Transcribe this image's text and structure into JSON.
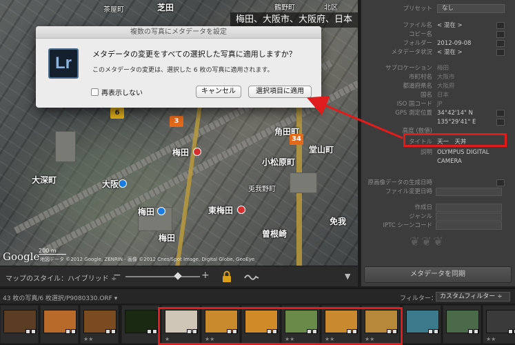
{
  "map": {
    "location_banner": "梅田、大阪市、大阪府、日本",
    "labels": [
      {
        "text": "茶屋町",
        "size": "sm"
      },
      {
        "text": "芝田",
        "size": "lg"
      },
      {
        "text": "鶴野町",
        "size": "sm"
      },
      {
        "text": "北区",
        "size": "sm"
      },
      {
        "text": "梅田",
        "size": "lg"
      },
      {
        "text": "角田町",
        "size": "lg"
      },
      {
        "text": "小松原町",
        "size": "lg"
      },
      {
        "text": "大阪",
        "size": "lg"
      },
      {
        "text": "大深町",
        "size": "lg"
      },
      {
        "text": "東梅田",
        "size": "lg"
      },
      {
        "text": "梅田",
        "size": "lg"
      },
      {
        "text": "曽根崎",
        "size": "lg"
      },
      {
        "text": "免我",
        "size": "lg"
      },
      {
        "text": "堂山町",
        "size": "lg"
      },
      {
        "text": "兎我野町",
        "size": "sm"
      },
      {
        "text": "梅田",
        "size": "lg"
      }
    ],
    "badges": [
      "6",
      "3",
      "34"
    ],
    "scale": "200 m",
    "google": "Google",
    "copyright": "地図データ ©2012 Google, ZENRIN - 画像 ©2012 Cnes/Spot Image, Digital Globe, GeoEye"
  },
  "dialog": {
    "title": "複数の写真にメタデータを設定",
    "icon_text": "Lr",
    "question": "メタデータの変更をすべての選択した写真に適用しますか？",
    "detail": "このメタデータの変更は、選択した 6 枚の写真に適用されます。",
    "dont_show": "再表示しない",
    "cancel": "キャンセル",
    "apply": "選択項目に適用"
  },
  "toolbar": {
    "map_style": "マップのスタイル：ハイブリッド ÷",
    "zoom_level": 0.72
  },
  "panel": {
    "preset_label": "プリセット",
    "preset_value": "なし",
    "rows": [
      {
        "label": "ファイル名",
        "value": "< 混在 >"
      },
      {
        "label": "コピー名",
        "value": ""
      },
      {
        "label": "フォルダー",
        "value": "2012-09-08"
      },
      {
        "label": "メタデータ状況",
        "value": "< 混在 >"
      },
      {
        "label": "サブロケーション",
        "value": "梅田",
        "dim": true
      },
      {
        "label": "市町村名",
        "value": "大阪市",
        "dim": true
      },
      {
        "label": "都道府県名",
        "value": "大阪府",
        "dim": true
      },
      {
        "label": "国名",
        "value": "日本",
        "dim": true
      },
      {
        "label": "ISO 国コード",
        "value": "JP",
        "dim": true
      },
      {
        "label": "GPS 測定位置",
        "value": "34°42'14\" N"
      },
      {
        "label": "",
        "value": "135°29'41\" E"
      },
      {
        "label": "高度 (数値)",
        "value": ""
      },
      {
        "label": "タイトル",
        "value": "天一　天丼"
      },
      {
        "label": "説明",
        "value": "OLYMPUS DIGITAL"
      },
      {
        "label": "",
        "value": "CAMERA"
      },
      {
        "label": "原画像データの生成日時",
        "value": ""
      },
      {
        "label": "ファイル変更日時",
        "value": ""
      },
      {
        "label": "作成日",
        "value": ""
      },
      {
        "label": "ジャンル",
        "value": ""
      },
      {
        "label": "IPTC シーンコード",
        "value": ""
      }
    ],
    "ornament": "❦❦❦",
    "sync_button": "メタデータを同期"
  },
  "filmstrip": {
    "count_text": "43 枚の写真/6 枚選択/P9080330.ORF ▾",
    "filter_label": "フィルター：",
    "filter_value": "カスタムフィルター ÷",
    "thumbs": [
      {
        "stars": "",
        "color": "#5a3d22"
      },
      {
        "stars": "",
        "color": "#b86a2a"
      },
      {
        "stars": "★★",
        "color": "#7a4a20"
      },
      {
        "stars": "",
        "color": "#1a2a12"
      },
      {
        "stars": "★",
        "color": "#cfc6b8"
      },
      {
        "stars": "★★",
        "color": "#c98a2e"
      },
      {
        "stars": "",
        "color": "#d18a28"
      },
      {
        "stars": "★★",
        "color": "#6a8a4a"
      },
      {
        "stars": "★★",
        "color": "#c9892e"
      },
      {
        "stars": "★★",
        "color": "#b8883a"
      },
      {
        "stars": "",
        "color": "#3a7a8a"
      },
      {
        "stars": "",
        "color": "#4a6a4a"
      },
      {
        "stars": "★★",
        "color": "#3a3a3a"
      }
    ]
  }
}
